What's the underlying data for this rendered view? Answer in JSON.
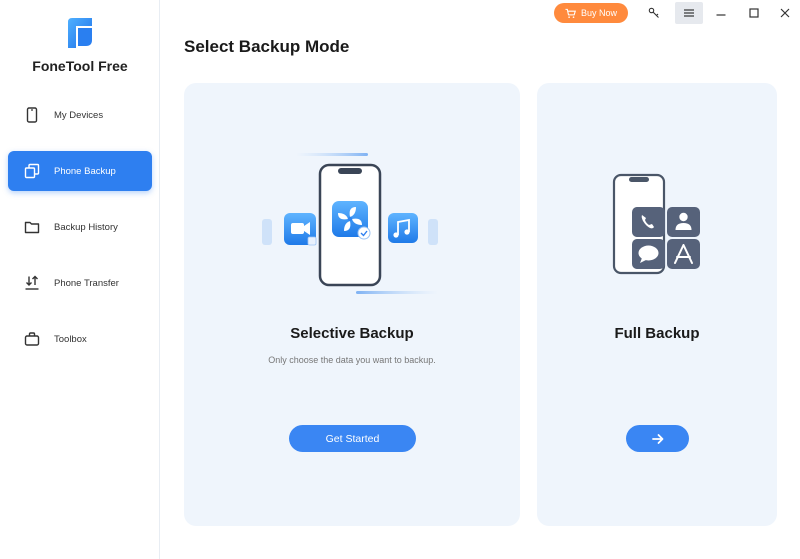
{
  "app": {
    "name": "FoneTool Free"
  },
  "sidebar": {
    "items": [
      {
        "label": "My Devices",
        "icon": "phone-icon",
        "active": false
      },
      {
        "label": "Phone Backup",
        "icon": "backup-icon",
        "active": true
      },
      {
        "label": "Backup History",
        "icon": "folder-icon",
        "active": false
      },
      {
        "label": "Phone Transfer",
        "icon": "transfer-icon",
        "active": false
      },
      {
        "label": "Toolbox",
        "icon": "toolbox-icon",
        "active": false
      }
    ]
  },
  "titlebar": {
    "buy_label": "Buy Now"
  },
  "main": {
    "title": "Select Backup Mode",
    "cards": {
      "selective": {
        "title": "Selective Backup",
        "description": "Only choose the data you want to backup.",
        "button_label": "Get Started"
      },
      "full": {
        "title": "Full Backup"
      }
    }
  },
  "colors": {
    "accent": "#2e7ff0",
    "button": "#3a86f3",
    "buy": "#ff8a3d",
    "card_bg": "#eff5fc"
  }
}
